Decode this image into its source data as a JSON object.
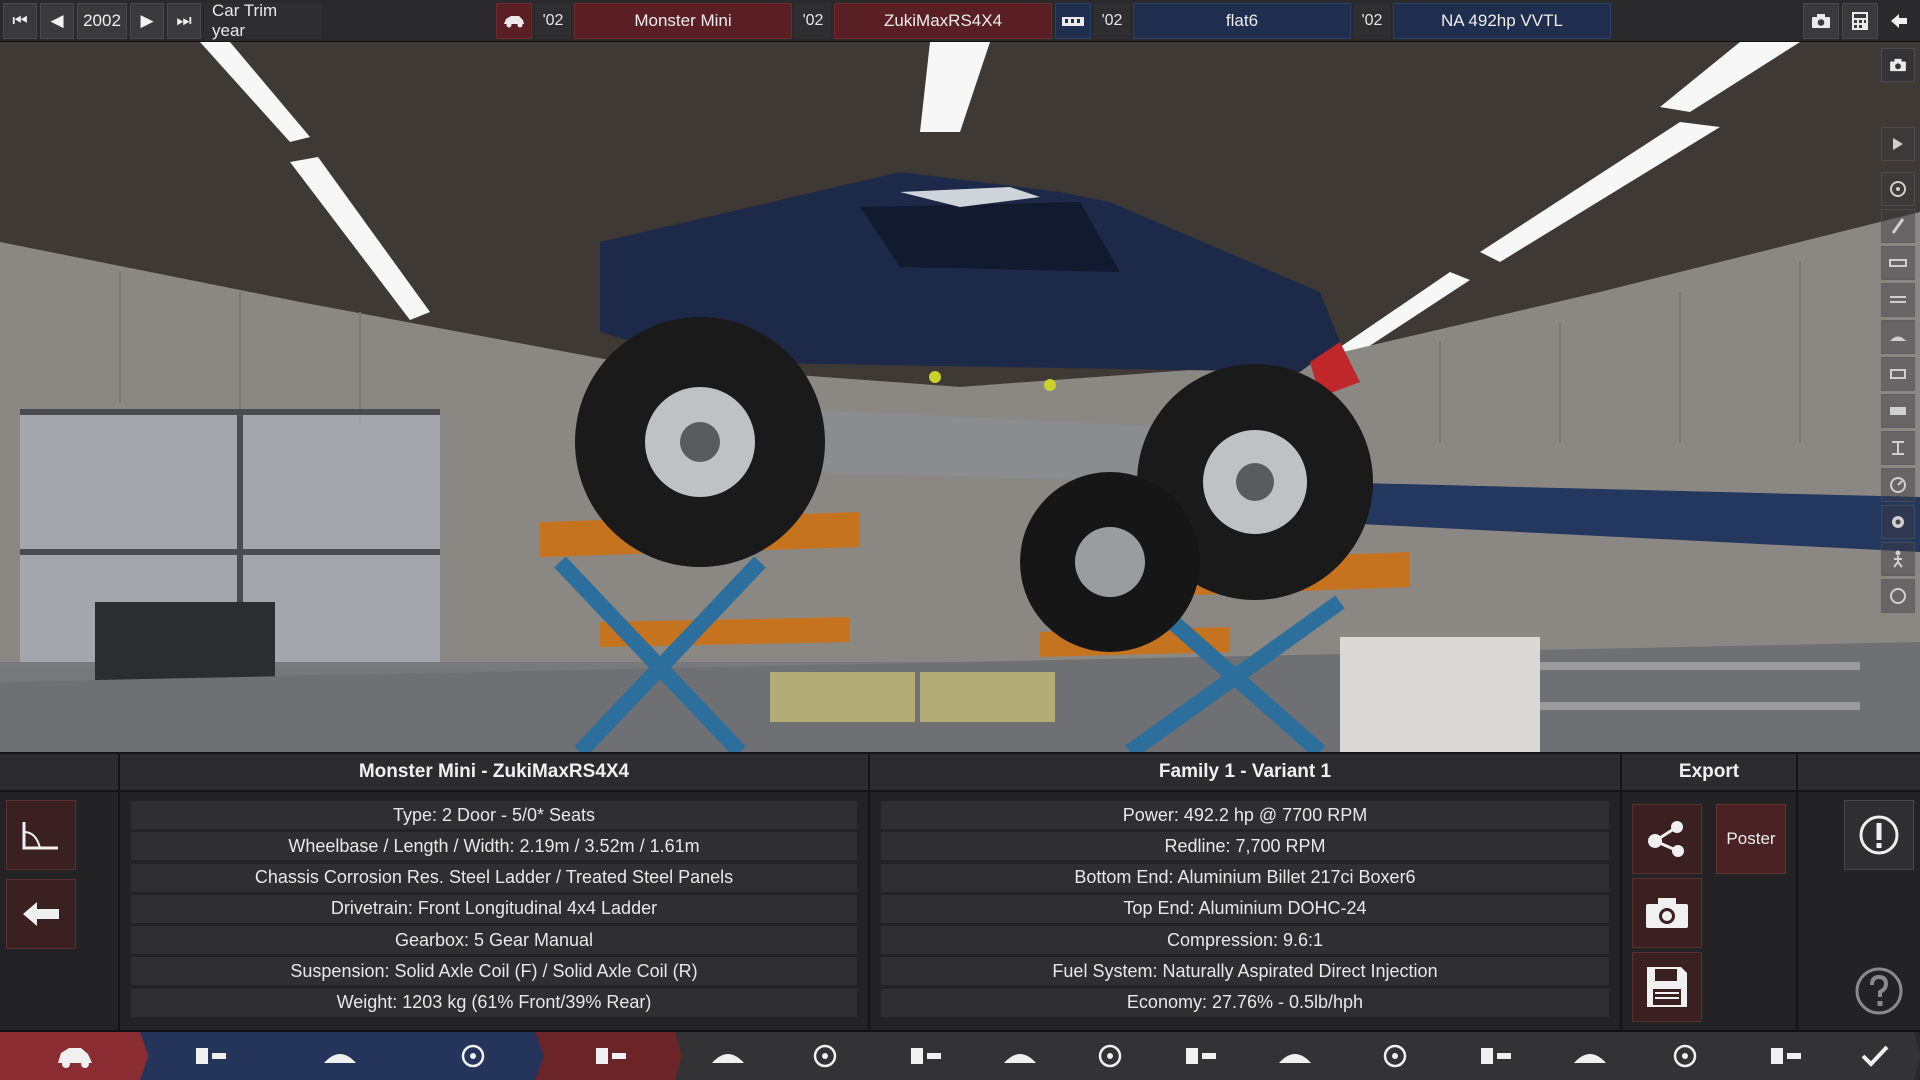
{
  "topbar": {
    "nav_first": "⏮",
    "nav_prev": "◀",
    "year": "2002",
    "nav_next": "▶",
    "nav_last": "⏭",
    "year_label": "Car Trim year",
    "model_year": "'02",
    "model_name": "Monster Mini",
    "trim_year": "'02",
    "trim_name": "ZukiMaxRS4X4",
    "engine_year": "'02",
    "engine_name": "flat6",
    "variant_year": "'02",
    "variant_name": "NA 492hp VVTL"
  },
  "info": {
    "car_header": "Monster Mini - ZukiMaxRS4X4",
    "car_rows": [
      "Type: 2 Door - 5/0* Seats",
      "Wheelbase / Length / Width: 2.19m / 3.52m / 1.61m",
      "Chassis Corrosion Res. Steel Ladder / Treated Steel Panels",
      "Drivetrain: Front Longitudinal 4x4 Ladder",
      "Gearbox: 5 Gear Manual",
      "Suspension: Solid Axle Coil (F) / Solid Axle Coil (R)",
      "Weight: 1203 kg (61% Front/39% Rear)"
    ],
    "engine_header": "Family 1 - Variant 1",
    "engine_rows": [
      "Power: 492.2 hp @ 7700 RPM",
      "Redline:  7,700 RPM",
      "Bottom End: Aluminium Billet 217ci Boxer6",
      "Top End: Aluminium DOHC-24",
      "Compression: 9.6:1",
      "Fuel System: Naturally Aspirated Direct Injection",
      "Economy: 27.76% - 0.5lb/hph"
    ],
    "export_header": "Export",
    "poster_label": "Poster"
  },
  "icons": {
    "nav": [
      "car-body-icon",
      "engine-family-icon",
      "engine-block-icon",
      "engine-tune-icon",
      "chassis-icon",
      "trim-icon",
      "drivetrain-icon",
      "gearbox-icon",
      "suspension-icon",
      "wheels-icon",
      "brakes-icon",
      "aero-icon",
      "interior-icon",
      "safety-icon",
      "tyres-icon",
      "cost-icon",
      "testing-icon",
      "finish-icon"
    ]
  },
  "colors": {
    "accent_red": "#6b2428",
    "accent_blue": "#24345a"
  }
}
